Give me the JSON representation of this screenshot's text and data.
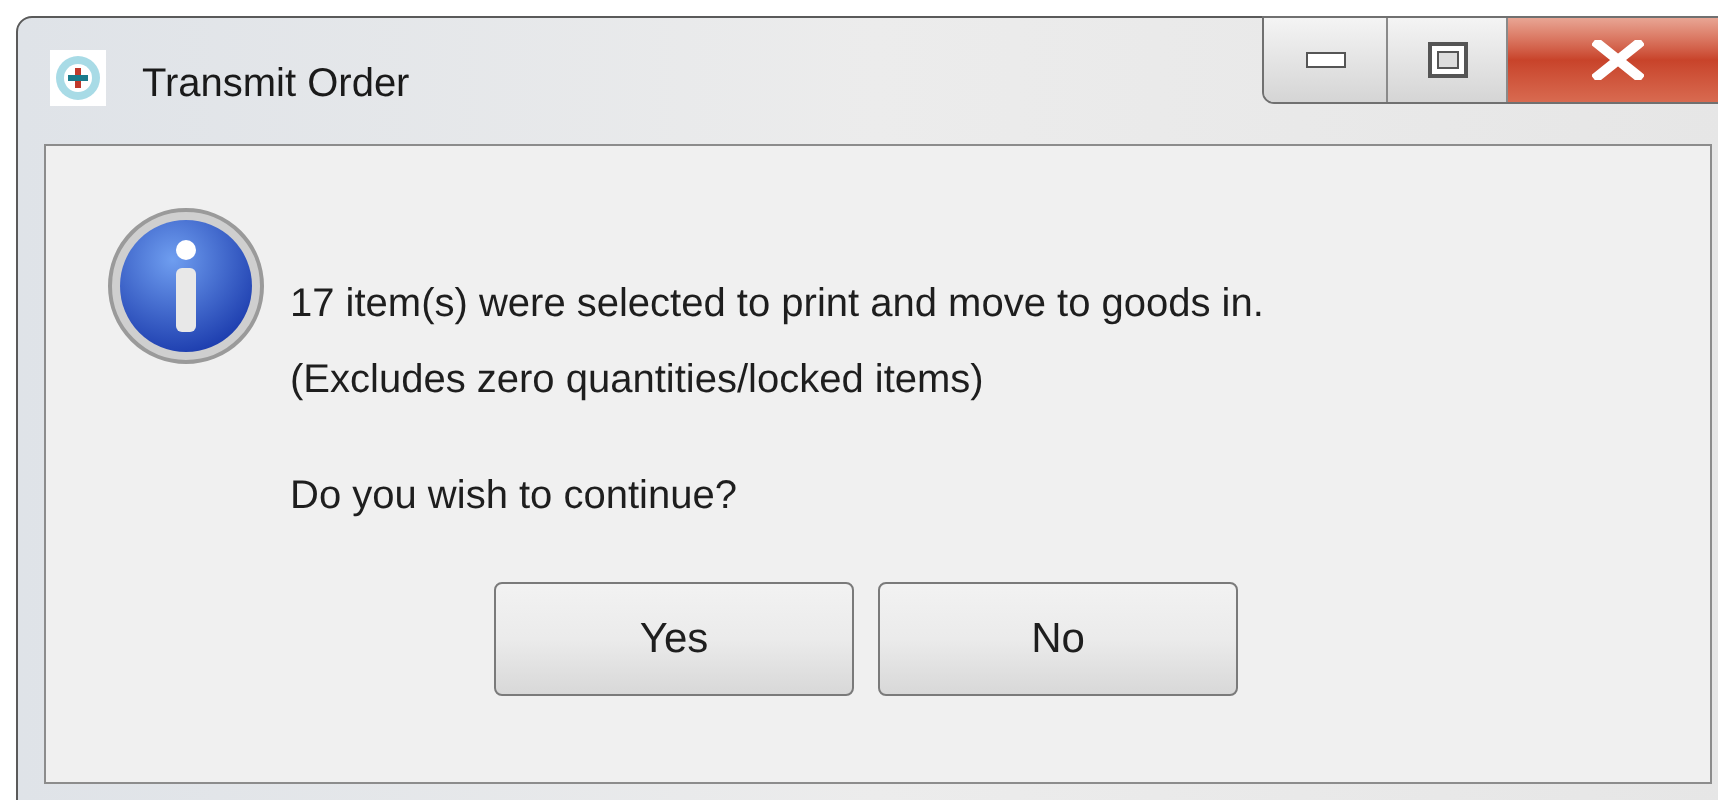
{
  "window": {
    "title": "Transmit Order"
  },
  "message": {
    "lines": [
      "17 item(s) were selected to print and move to goods in.",
      "(Excludes zero quantities/locked items)"
    ],
    "question": "Do you wish to continue?"
  },
  "buttons": [
    "Yes",
    "No"
  ]
}
